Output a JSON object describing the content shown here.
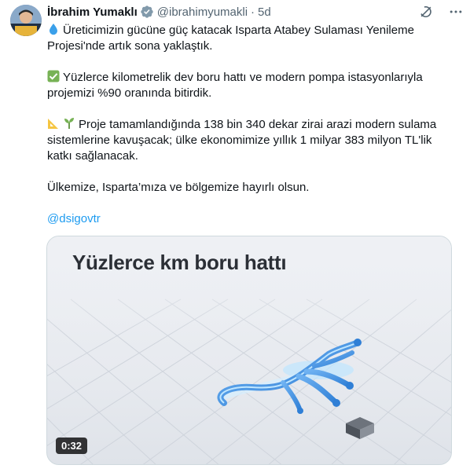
{
  "author": {
    "name": "İbrahim Yumaklı",
    "handle": "@ibrahimyumakli",
    "time": "5d",
    "separator": "·"
  },
  "icons": {
    "verified": "verified-badge-icon",
    "grok": "grok-icon",
    "more": "more-icon"
  },
  "tweet": {
    "line1": "Üreticimizin gücüne güç katacak Isparta Atabey Sulaması Yenileme Projesi'nde artık sona yaklaştık.",
    "line2": "Yüzlerce kilometrelik dev boru hattı ve modern pompa istasyonlarıyla projemizi %90 oranında bitirdik.",
    "line3": "Proje tamamlandığında 138 bin 340 dekar zirai arazi modern sulama sistemlerine kavuşacak; ülke ekonomimize yıllık 1 milyar 383 milyon TL'lik katkı sağlanacak.",
    "line4": "Ülkemize, Isparta’mıza ve bölgemize hayırlı olsun.",
    "mention": "@dsigovtr"
  },
  "media": {
    "title": "Yüzlerce km boru hattı",
    "duration": "0:32"
  },
  "colors": {
    "accent": "#1d9bf0",
    "secondary_text": "#536471",
    "pipe": "#3d8fe0",
    "glow": "#bfe6ff"
  }
}
